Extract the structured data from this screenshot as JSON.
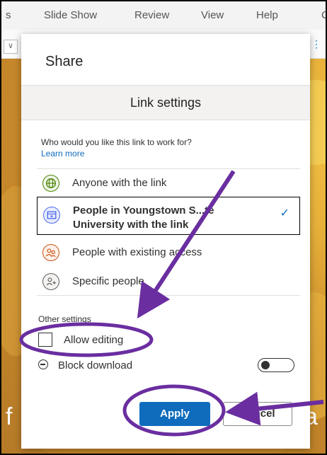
{
  "ribbon": {
    "menu": [
      "s",
      "Slide Show",
      "Review",
      "View",
      "Help",
      "C"
    ]
  },
  "slide": {
    "left_text": "f",
    "right_text": "a"
  },
  "dialog": {
    "title": "Share",
    "subheader": "Link settings",
    "question": "Who would you like this link to work for?",
    "learn_more": "Learn more",
    "options": [
      {
        "label": "Anyone with the link",
        "icon": "globe-icon",
        "selected": false
      },
      {
        "label": "People in Youngstown S...te University with the link",
        "icon": "building-icon",
        "selected": true
      },
      {
        "label": "People with existing access",
        "icon": "people-icon",
        "selected": false
      },
      {
        "label": "Specific people",
        "icon": "person-add-icon",
        "selected": false
      }
    ],
    "other_settings": "Other settings",
    "allow_editing": {
      "label": "Allow editing",
      "checked": false
    },
    "block_download": {
      "label": "Block download",
      "on": false
    },
    "apply_label": "Apply",
    "cancel_label": "Cancel"
  },
  "annotation": {
    "color": "#6a2ea0"
  }
}
